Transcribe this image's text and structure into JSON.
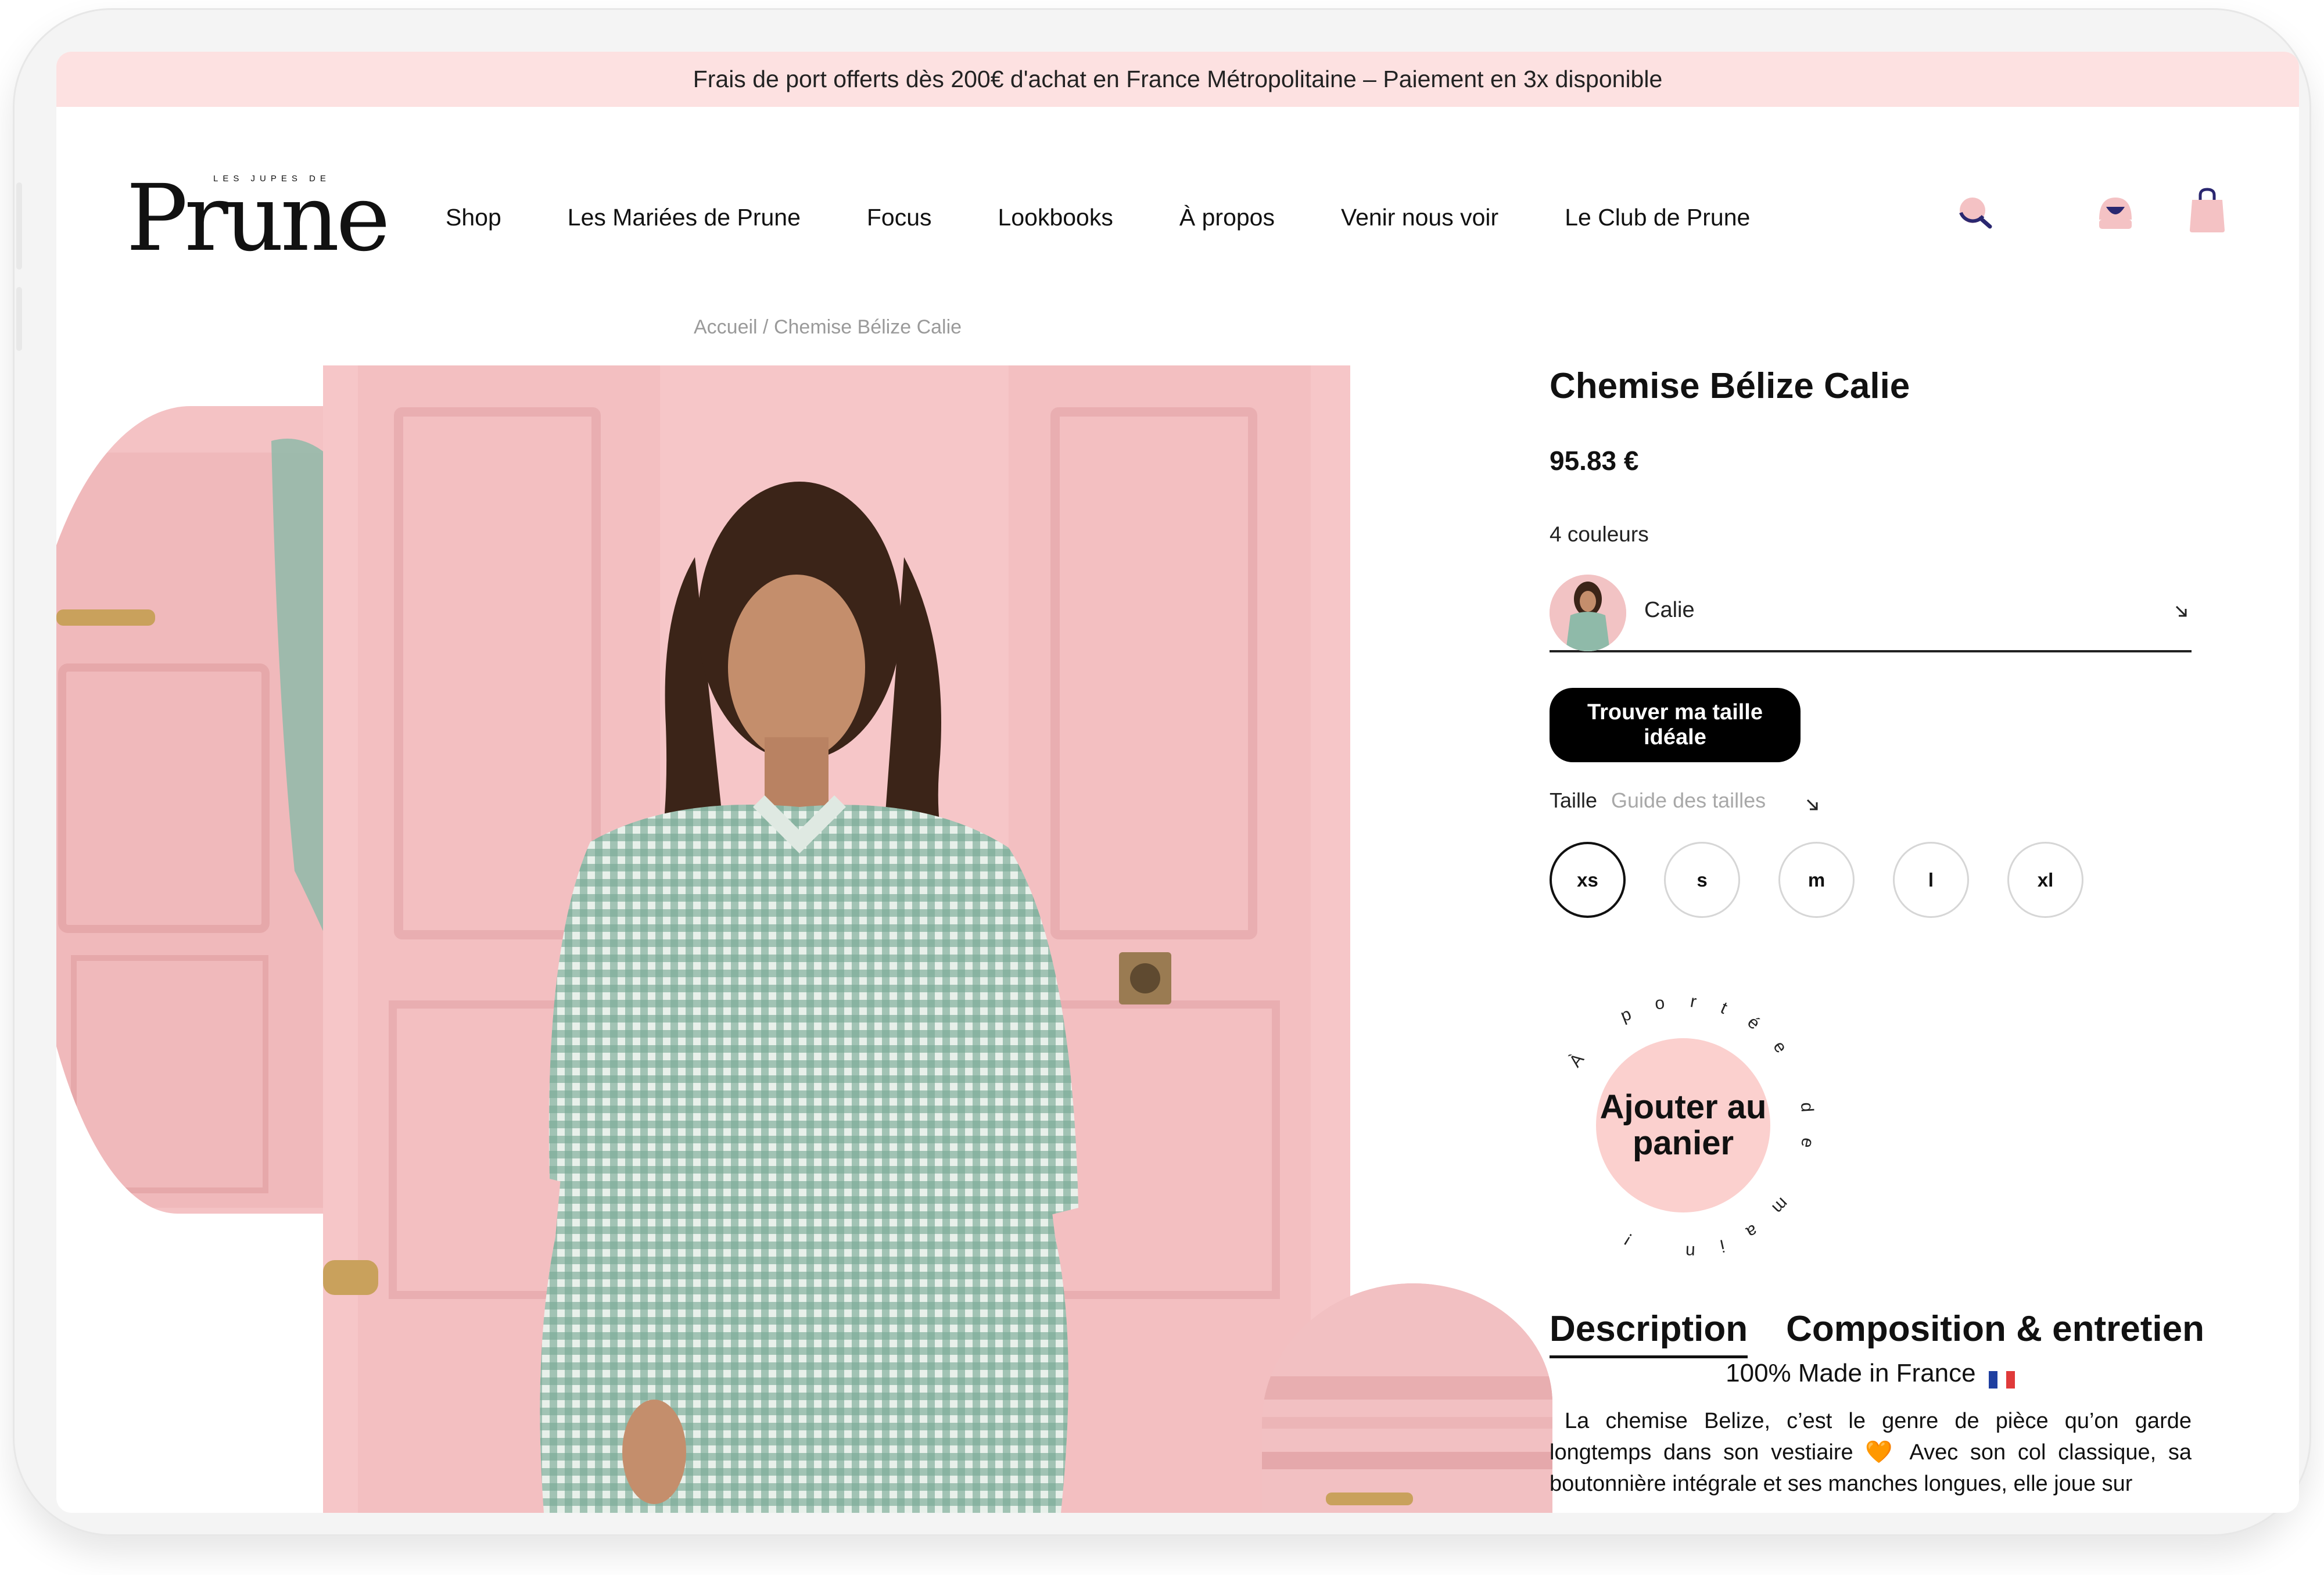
{
  "promo": {
    "text": "Frais de port offerts dès 200€ d'achat en France Métropolitaine – Paiement en 3x disponible"
  },
  "logo": {
    "small": "LES JUPES DE",
    "big": "Prune"
  },
  "nav": {
    "items": [
      "Shop",
      "Les Mariées de Prune",
      "Focus",
      "Lookbooks",
      "À propos",
      "Venir nous voir",
      "Le Club de Prune"
    ]
  },
  "header_icons": [
    "search-icon",
    "account-icon",
    "bag-icon"
  ],
  "breadcrumb": "Accueil / Chemise Bélize Calie",
  "product": {
    "title": "Chemise Bélize Calie",
    "price": "95.83 €",
    "colors_count": "4 couleurs",
    "selected_color": "Calie",
    "find_size_label": "Trouver ma taille idéale",
    "size_label": "Taille",
    "size_guide_label": "Guide des tailles",
    "sizes": [
      "xs",
      "s",
      "m",
      "l",
      "xl"
    ],
    "selected_size": "xs",
    "add_to_cart": "Ajouter au panier",
    "circular_text": "À portée de main !"
  },
  "tabs": [
    "Description",
    "Composition & entretien"
  ],
  "description": {
    "headline": "100% Made in France",
    "body": "La chemise Belize, c’est le genre de pièce qu’on garde longtemps dans son vestiaire 🧡 Avec son col classique, sa boutonnière intégrale et ses manches longues, elle joue sur"
  },
  "colors": {
    "promo_bg": "#fde1e1",
    "accent_pink": "#f4c2c4",
    "button_black": "#000000",
    "cart_pink": "#fbd0ce",
    "icon_navy": "#2a2770"
  }
}
